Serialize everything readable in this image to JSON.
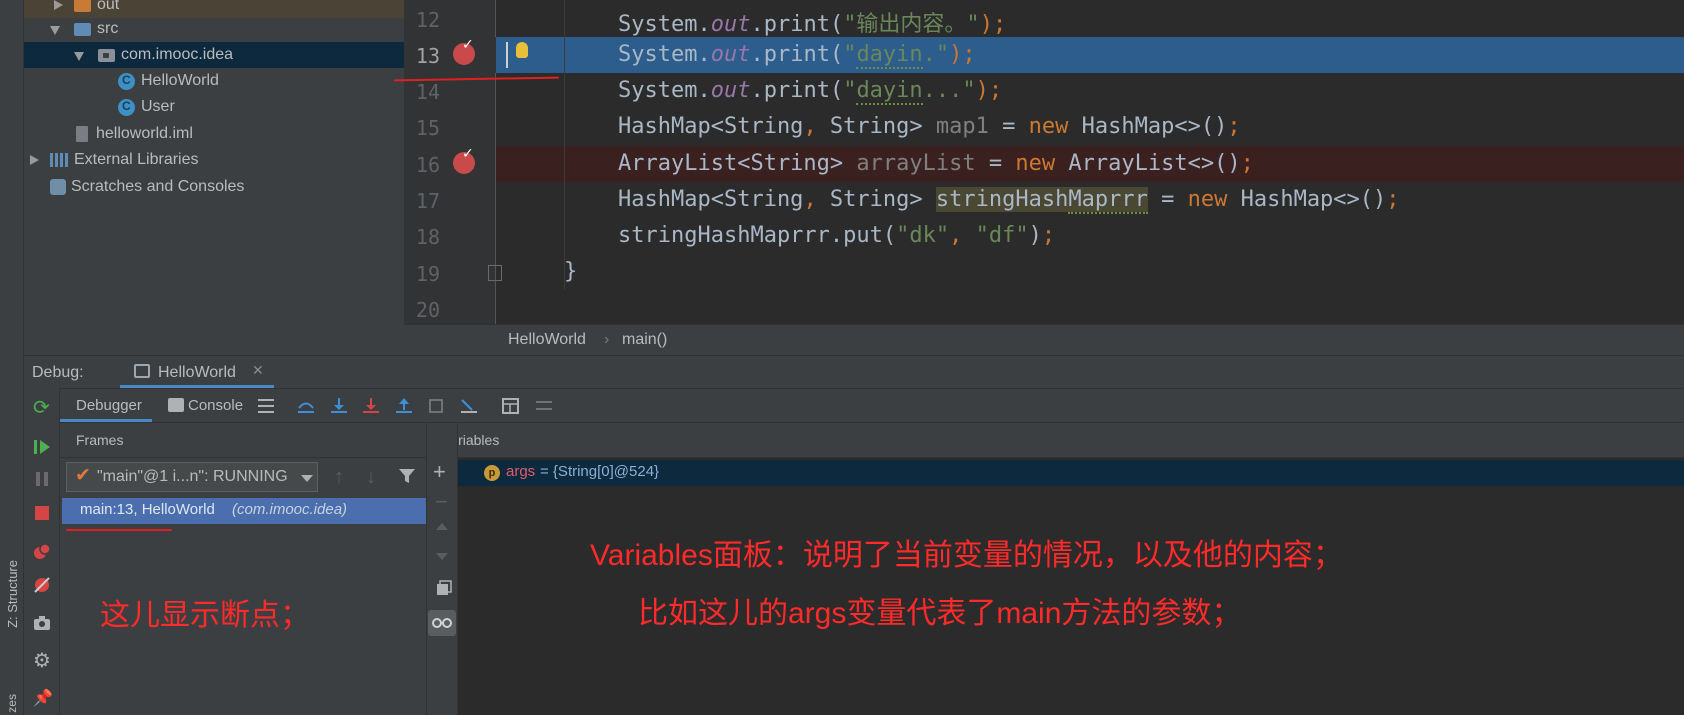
{
  "project_tree": {
    "items": [
      {
        "label": "out",
        "icon": "folder-orange-icon"
      },
      {
        "label": "src",
        "icon": "folder-blue-icon"
      },
      {
        "label": "com.imooc.idea",
        "icon": "package-icon"
      },
      {
        "label": "HelloWorld",
        "icon": "java-class-icon"
      },
      {
        "label": "User",
        "icon": "java-class-icon"
      },
      {
        "label": "helloworld.iml",
        "icon": "iml-file-icon"
      },
      {
        "label": "External Libraries",
        "icon": "library-icon"
      },
      {
        "label": "Scratches and Consoles",
        "icon": "scratches-icon"
      }
    ]
  },
  "side_strip": {
    "structure_label": "Z: Structure",
    "favorites_label": "zes"
  },
  "editor": {
    "line_numbers": [
      "12",
      "13",
      "14",
      "15",
      "16",
      "17",
      "18",
      "19",
      "20"
    ],
    "breadcrumb": {
      "file": "HelloWorld",
      "method": "main()"
    }
  },
  "debug": {
    "label": "Debug:",
    "tab_title": "HelloWorld",
    "tabs": {
      "debugger": "Debugger",
      "console": "Console"
    },
    "frames": {
      "title": "Frames",
      "thread": "\"main\"@1 i...n\": RUNNING",
      "current_frame_main": "main:13, HelloWorld",
      "current_frame_pkg": "(com.imooc.idea)"
    },
    "variables": {
      "title": "Variables",
      "var_name": "args",
      "var_value": " = {String[0]@524}",
      "var_badge": "p"
    }
  },
  "annotations": {
    "left_note": "这儿显示断点；",
    "right_note_1": "Variables面板：说明了当前变量的情况，以及他的内容；",
    "right_note_2": "比如这儿的args变量代表了main方法的参数；"
  },
  "colors": {
    "accent": "#4a88c7",
    "selection": "#2d5d8c",
    "breakpoint": "#c94a4a",
    "annotation": "#ff2a2a"
  }
}
